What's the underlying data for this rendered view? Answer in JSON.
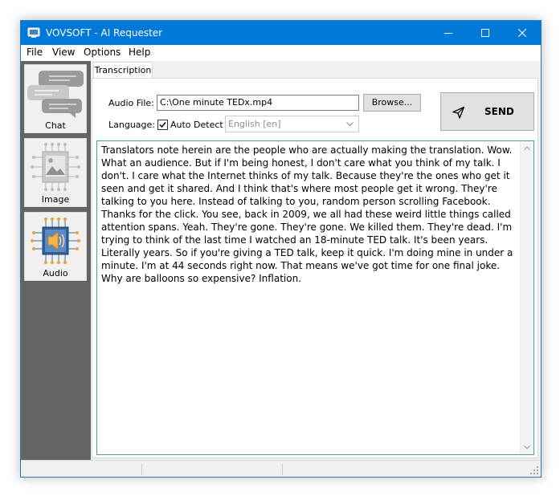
{
  "window": {
    "title": "VOVSOFT - AI Requester",
    "title_bar_color": "#0078d7"
  },
  "menu": {
    "items": [
      {
        "label": "File"
      },
      {
        "label": "View"
      },
      {
        "label": "Options"
      },
      {
        "label": "Help"
      }
    ]
  },
  "sidebar": {
    "background": "#646464",
    "items": [
      {
        "label": "Chat",
        "icon": "chat-bubbles-icon"
      },
      {
        "label": "Image",
        "icon": "image-circuit-icon"
      },
      {
        "label": "Audio",
        "icon": "speaker-icon",
        "active": true
      }
    ]
  },
  "tabs": [
    {
      "label": "Transcription",
      "active": true
    }
  ],
  "form": {
    "audio_file_label": "Audio File:",
    "audio_file_value": "C:\\One minute TEDx.mp4",
    "browse_label": "Browse...",
    "language_label": "Language:",
    "auto_detect_label": "Auto Detect",
    "auto_detect_checked": true,
    "language_value": "English [en]",
    "send_label": "SEND"
  },
  "transcription": {
    "text": "Translators note herein are the people who are actually making the translation. Wow. What an audience. But if I'm being honest, I don't care what you think of my talk. I don't. I care what the Internet thinks of my talk. Because they're the ones who get it seen and get it shared. And I think that's where most people get it wrong. They're talking to you here. Instead of talking to you, random person scrolling Facebook. Thanks for the click. You see, back in 2009, we all had these weird little things called attention spans. Yeah. They're gone. They're gone. We killed them. They're dead. I'm trying to think of the last time I watched an 18-minute TED talk. It's been years. Literally years. So if you're giving a TED talk, keep it quick. I'm doing mine in under a minute. I'm at 44 seconds right now. That means we've got time for one final joke. Why are balloons so expensive? Inflation."
  }
}
